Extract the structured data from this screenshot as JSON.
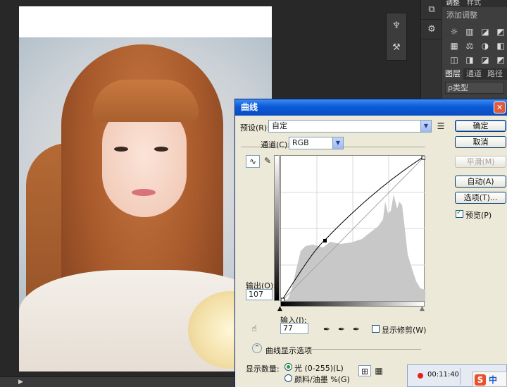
{
  "panel": {
    "tabs": [
      "调整",
      "样式"
    ],
    "subtitle": "添加调整",
    "adjust_icons": [
      "☼",
      "▥",
      "◪",
      "◩",
      "▦",
      "⚖",
      "◑",
      "◧",
      "◫",
      "◨",
      "◪",
      "◩"
    ],
    "layer_tabs": [
      "图层",
      "通道",
      "路径"
    ],
    "layer_filter": "ρ类型"
  },
  "curves": {
    "title": "曲线",
    "preset_label": "预设(R):",
    "preset_value": "自定",
    "channel_label": "通道(C):",
    "channel_value": "RGB",
    "output_label": "输出(O):",
    "output_value": "107",
    "input_label": "输入(I):",
    "input_value": "77",
    "show_clipping_label": "显示修剪(W)",
    "display_options_label": "曲线显示选项",
    "show_amount_label": "显示数量:",
    "radio_light_label": "光 (0-255)(L)",
    "radio_pigment_label": "颜料/油墨 %(G)",
    "preview_label": "预览(P)",
    "preview_checked": true,
    "show_clipping_checked": false,
    "buttons": {
      "ok": "确定",
      "cancel": "取消",
      "smooth": "平滑(M)",
      "auto": "自动(A)",
      "options": "选项(T)..."
    },
    "curve_point": {
      "input": 77,
      "output": 107
    }
  },
  "taskbar": {
    "record_time": "00:11:40",
    "ime_logo": "S",
    "ime_mode": "中"
  }
}
